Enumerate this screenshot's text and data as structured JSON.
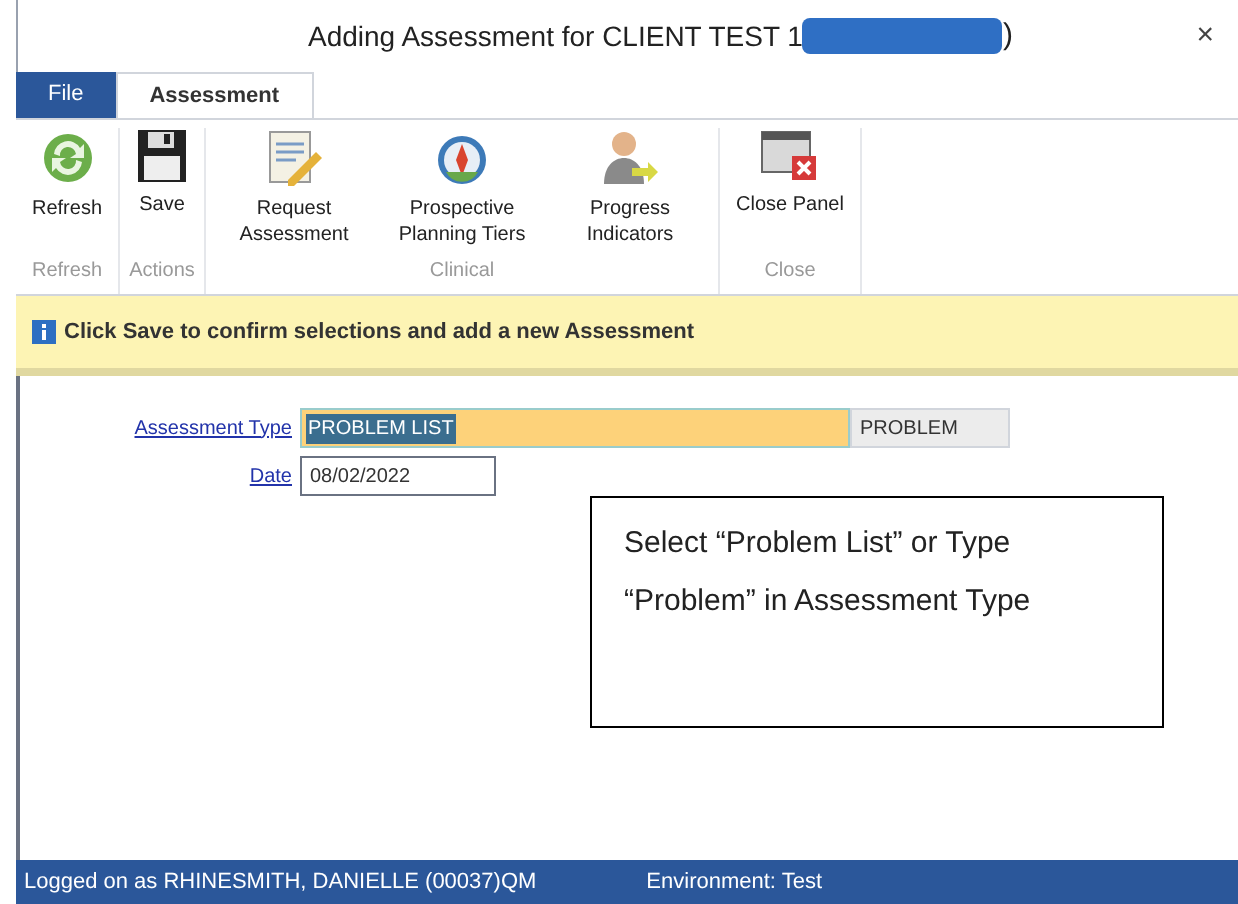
{
  "window": {
    "title": "Adding Assessment for CLIENT TEST 1",
    "title_suffix": ")",
    "close": "×"
  },
  "tabs": [
    {
      "label": "File",
      "kind": "file",
      "selected": false
    },
    {
      "label": "Assessment",
      "kind": "tab",
      "selected": true
    }
  ],
  "ribbon_groups": [
    {
      "label": "Refresh",
      "buttons": [
        {
          "label": "Refresh",
          "kind": "refresh"
        }
      ]
    },
    {
      "label": "Actions",
      "buttons": [
        {
          "label": "Save",
          "kind": "save"
        }
      ]
    },
    {
      "label": "Clinical",
      "buttons": [
        {
          "label": "Request Assessment",
          "kind": "request"
        },
        {
          "label": "Prospective Planning Tiers",
          "kind": "tiers"
        },
        {
          "label": "Progress Indicators",
          "kind": "progress"
        }
      ]
    },
    {
      "label": "Close",
      "buttons": [
        {
          "label": "Close Panel",
          "kind": "close"
        }
      ]
    }
  ],
  "info_bar": {
    "text": "Click Save to confirm selections and add a new Assessment"
  },
  "form": [
    {
      "label": "Assessment Type",
      "kind": "select",
      "value": "PROBLEM LIST",
      "code": "PROBLEM"
    },
    {
      "label": "Date",
      "kind": "date",
      "value": "08/02/2022"
    }
  ],
  "callout": {
    "text": "Select “Problem List” or Type “Problem” in Assessment Type"
  },
  "status_bar": {
    "user": "Logged on as RHINESMITH, DANIELLE (00037)QM",
    "environment": "Environment: Test"
  }
}
